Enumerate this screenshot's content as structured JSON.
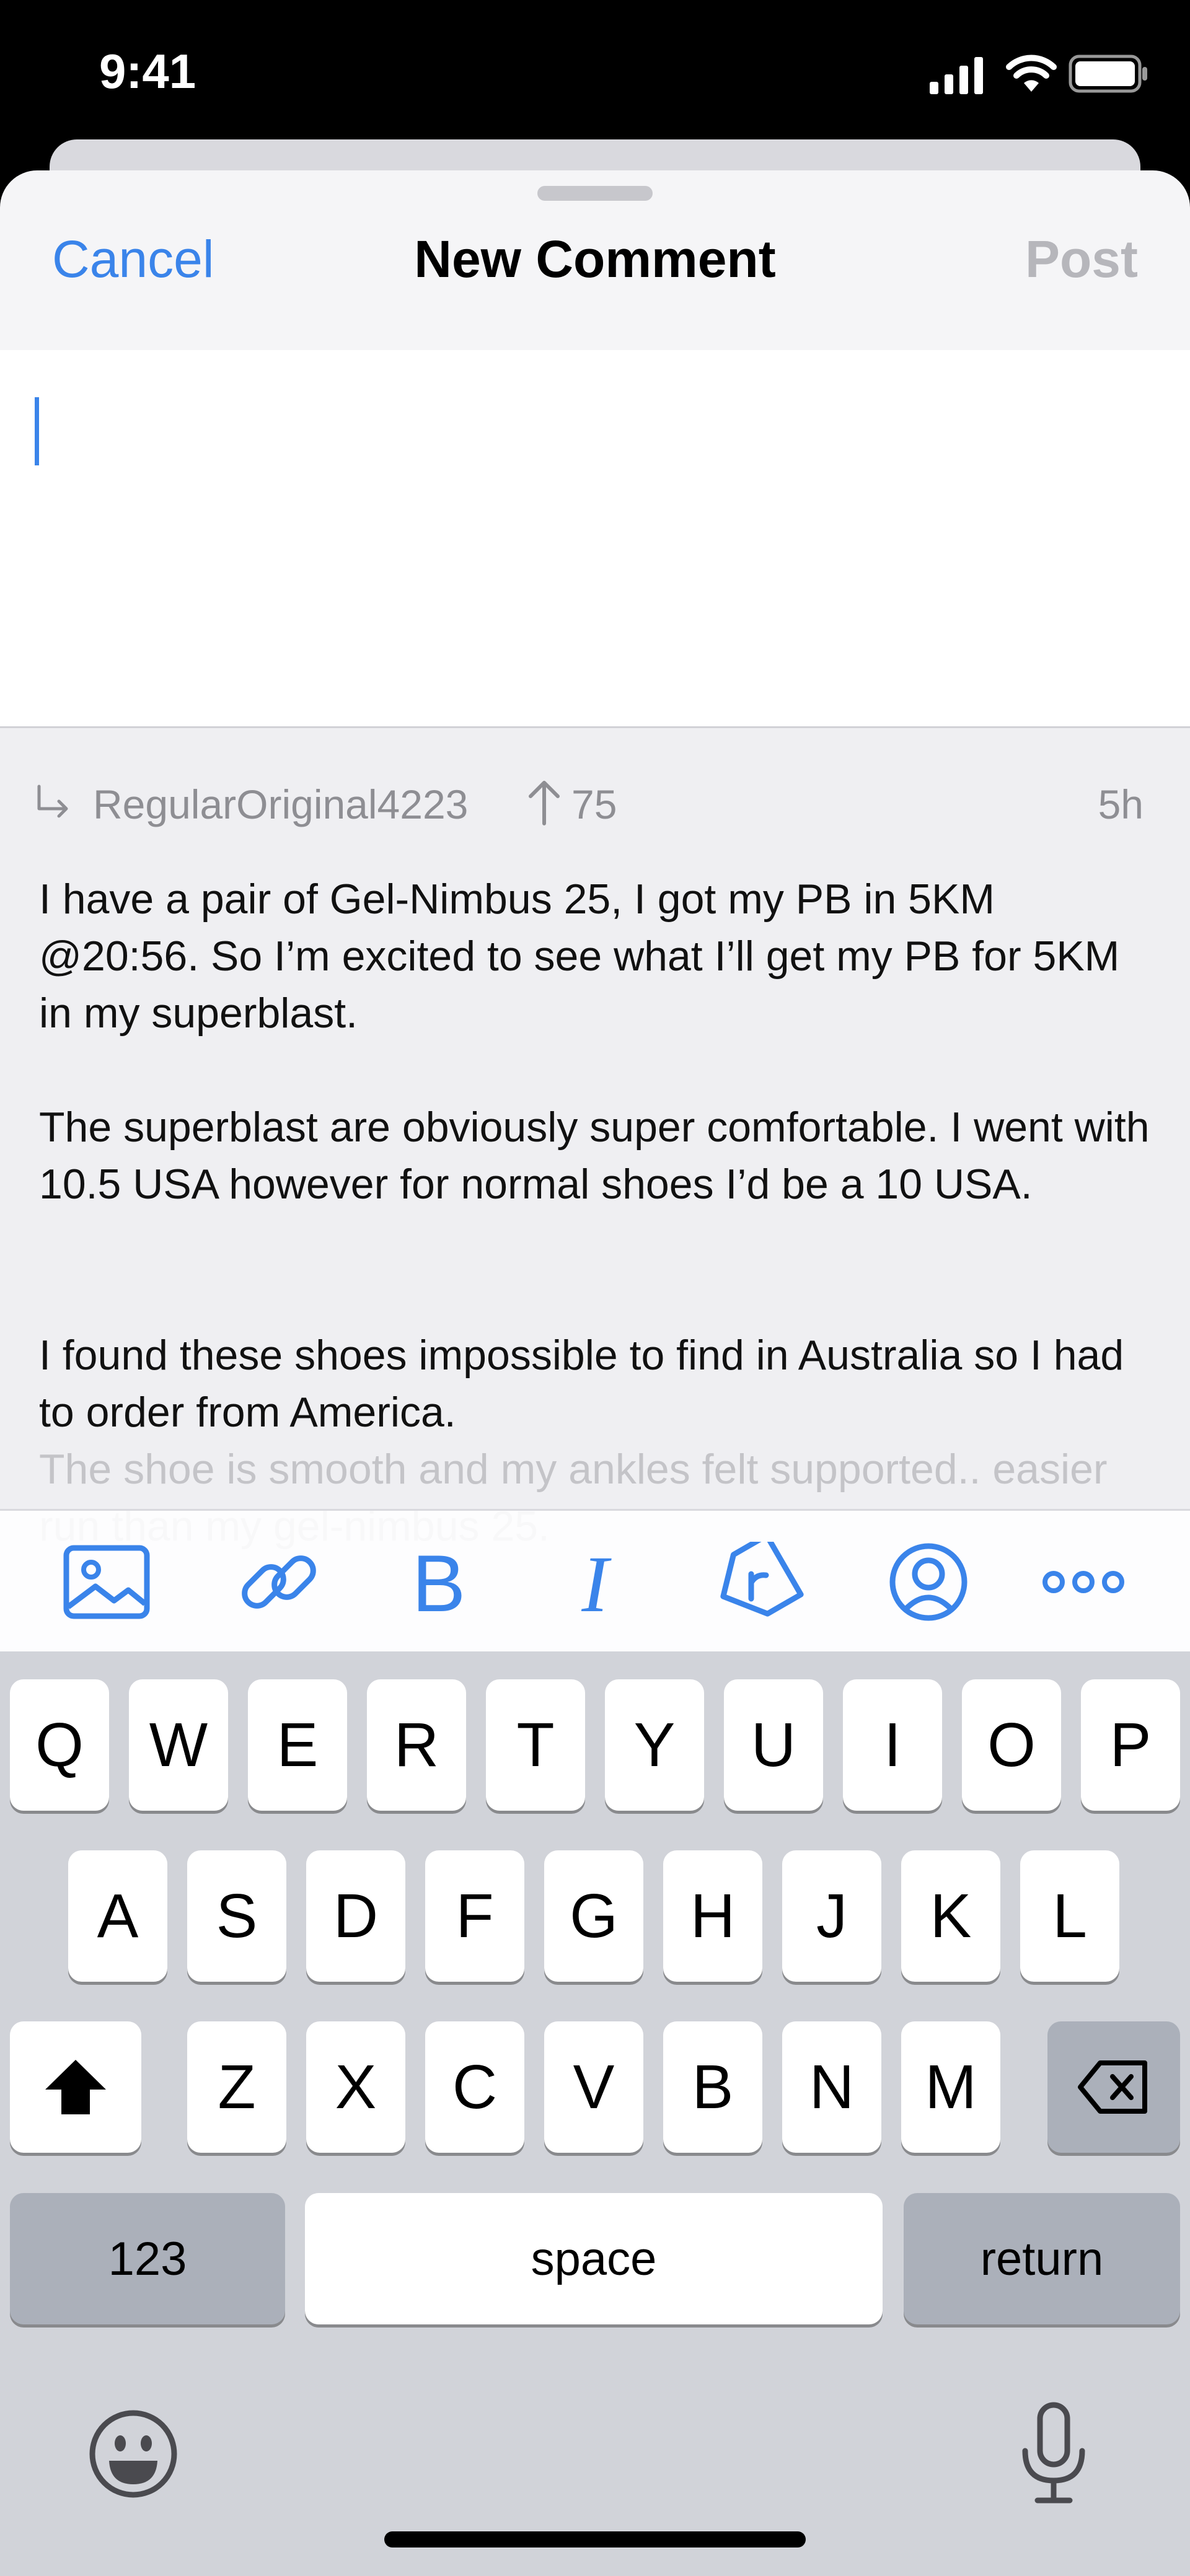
{
  "status_bar": {
    "time": "9:41"
  },
  "nav": {
    "cancel": "Cancel",
    "title": "New Comment",
    "post": "Post"
  },
  "quote": {
    "username": "RegularOriginal4223",
    "upvotes": "75",
    "time_ago": "5h",
    "paragraphs": [
      "I have a pair of Gel-Nimbus 25, I got my PB in 5KM @20:56. So I’m excited to see what I’ll get my PB for 5KM in my superblast.",
      "The superblast are obviously super comfortable. I went with 10.5 USA however for normal shoes I’d be a 10 USA.",
      "I found these shoes impossible to find in Australia so I had to order from America.",
      "The shoe is smooth and my ankles felt supported.. easier run than my gel-nimbus 25."
    ]
  },
  "toolbar": {
    "icons": [
      "image-icon",
      "link-icon",
      "bold-icon",
      "italic-icon",
      "flair-tag-icon",
      "user-mention-icon",
      "more-icon"
    ],
    "bold_glyph": "B",
    "italic_glyph": "I"
  },
  "keyboard": {
    "row1": [
      "Q",
      "W",
      "E",
      "R",
      "T",
      "Y",
      "U",
      "I",
      "O",
      "P"
    ],
    "row2": [
      "A",
      "S",
      "D",
      "F",
      "G",
      "H",
      "J",
      "K",
      "L"
    ],
    "row3": [
      "Z",
      "X",
      "C",
      "V",
      "B",
      "N",
      "M"
    ],
    "numbers_key": "123",
    "space_key": "space",
    "return_key": "return"
  },
  "colors": {
    "accent": "#3a84ea",
    "disabled": "#b6b6bb",
    "meta_gray": "#8e8e93"
  }
}
